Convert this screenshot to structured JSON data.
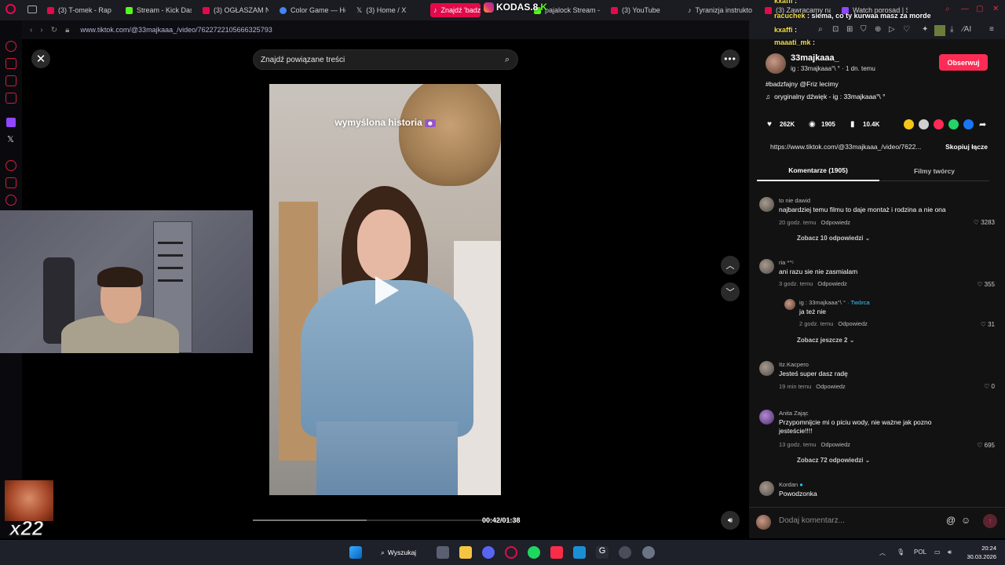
{
  "browser": {
    "tabs": [
      {
        "label": "(3) T-omek - Rap",
        "color": "#e30a4a"
      },
      {
        "label": "Stream - Kick Das",
        "color": "#53fc18"
      },
      {
        "label": "(3) OGŁASZAM N",
        "color": "#e30a4a"
      },
      {
        "label": "Color Game — Ho",
        "color": "#4285f4"
      },
      {
        "label": "(3) Home / X",
        "color": "#ffffff"
      },
      {
        "label": "Znajdź 'badz",
        "color": "#ffffff"
      },
      {
        "label": "pajalock Stream -",
        "color": "#53fc18"
      },
      {
        "label": "(3) YouTube",
        "color": "#e30a4a"
      },
      {
        "label": "Tyranizja instrukto",
        "color": "#ffffff"
      },
      {
        "label": "(3) Zawracamy na",
        "color": "#e30a4a"
      },
      {
        "label": "Watch porosad | S",
        "color": "#9146ff"
      }
    ],
    "url": "www.tiktok.com/@33majkaaa_/video/7622722105666325793"
  },
  "overlay": {
    "kodas": "KODAS.8",
    "x22": "x22",
    "chat": [
      {
        "nick": "kxaffi",
        "text": ":"
      },
      {
        "nick": "racuchek",
        "text": ": siema, co ty kurwaa masz za morde"
      },
      {
        "nick": "kxaffi",
        "text": ":"
      },
      {
        "nick": "maaati_mk",
        "text": ":"
      }
    ]
  },
  "video": {
    "search_placeholder": "Znajdź powiązane treści",
    "caption": "wymyślona historia",
    "time": "00:42/01:38",
    "progress": 0.43
  },
  "author": {
    "name": "33majkaaa_",
    "meta": "ig : 33majkaaa°\\ ° · 1 dn. temu",
    "follow": "Obserwuj",
    "description": "#badzfajny @Friz lecimy",
    "sound": "oryginalny dźwięk - ig : 33majkaaa°\\ °"
  },
  "stats": {
    "likes": "262K",
    "comments": "1905",
    "saves": "10.4K"
  },
  "share": {
    "link": "https://www.tiktok.com/@33majkaaa_/video/7622...",
    "copy": "Skopiuj łącze",
    "colors": [
      "#f5c518",
      "#cfcfcf",
      "#fe2c55",
      "#25d366",
      "#1877f2"
    ]
  },
  "tabs": {
    "comments": "Komentarze (1905)",
    "creator": "Filmy twórcy"
  },
  "comments": [
    {
      "user": "to nie dawid",
      "text": "najbardziej temu filmu to daje montaż i rodzina a nie ona",
      "time": "20 godz. temu",
      "reply": "Odpowiedz",
      "likes": "3283",
      "more": "Zobacz 10 odpowiedzi"
    },
    {
      "user": "ria *°ᶜ",
      "text": "ani razu sie nie zasmialam",
      "time": "3 godz. temu",
      "reply": "Odpowiedz",
      "likes": "355"
    },
    {
      "user": "ig : 33majkaaa°\\ °",
      "creator": "· Twórca",
      "text": "ja też nie",
      "time": "2 godz. temu",
      "reply": "Odpowiedz",
      "likes": "31",
      "more": "Zobacz jeszcze 2"
    },
    {
      "user": "Itz.Kacpero",
      "text": "Jesteś super dasz radę",
      "time": "19 min temu",
      "reply": "Odpowiedz",
      "likes": "0"
    },
    {
      "user": "Anita Zając",
      "text": "Przypomnijcie mi o piciu wody, nie ważne jak pozno jesteście!!!!",
      "time": "13 godz. temu",
      "reply": "Odpowiedz",
      "likes": "695",
      "more": "Zobacz 72 odpowiedzi"
    },
    {
      "user": "Kordan",
      "text": "Powodzonka",
      "time": "",
      "reply": "",
      "likes": ""
    }
  ],
  "input": {
    "placeholder": "Dodaj komentarz..."
  },
  "taskbar": {
    "search": "Wyszukaj",
    "lang": "POL",
    "time": "20:24",
    "date": "30.03.2026"
  }
}
